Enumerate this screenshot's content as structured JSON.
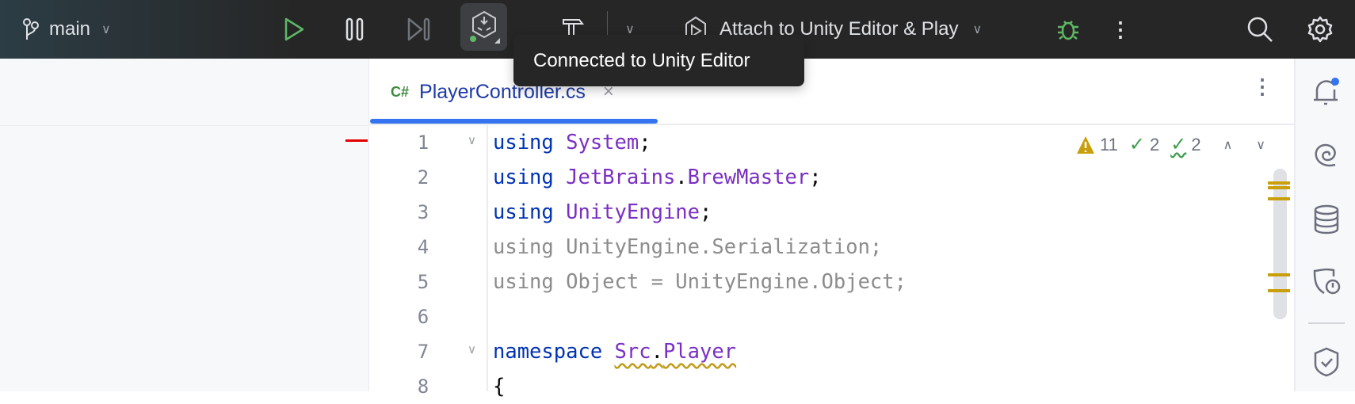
{
  "toolbar": {
    "branch": "main",
    "run_config": "Attach to Unity Editor & Play",
    "icons": [
      "branch-icon",
      "play-icon",
      "pause-icon",
      "step-icon",
      "unity-connection-icon",
      "hammer-icon",
      "chevron-down-icon",
      "run-config-icon",
      "debug-bug-icon",
      "more-icon",
      "search-icon",
      "gear-icon"
    ]
  },
  "tooltip": {
    "text": "Connected to Unity Editor"
  },
  "tab": {
    "lang": "C#",
    "filename": "PlayerController.cs"
  },
  "inspections": {
    "warnings": "11",
    "weak_warnings": "2",
    "typos": "2"
  },
  "editor": {
    "line_numbers": [
      "1",
      "2",
      "3",
      "4",
      "5",
      "6",
      "7",
      "8"
    ],
    "lines": [
      [
        {
          "t": "using",
          "c": "kw"
        },
        {
          "t": " ",
          "c": "pl"
        },
        {
          "t": "System",
          "c": "ns"
        },
        {
          "t": ";",
          "c": "pl"
        }
      ],
      [
        {
          "t": "using",
          "c": "kw"
        },
        {
          "t": " ",
          "c": "pl"
        },
        {
          "t": "JetBrains",
          "c": "ns"
        },
        {
          "t": ".",
          "c": "pl"
        },
        {
          "t": "BrewMaster",
          "c": "ns"
        },
        {
          "t": ";",
          "c": "pl"
        }
      ],
      [
        {
          "t": "using",
          "c": "kw"
        },
        {
          "t": " ",
          "c": "pl"
        },
        {
          "t": "UnityEngine",
          "c": "ns"
        },
        {
          "t": ";",
          "c": "pl"
        }
      ],
      [
        {
          "t": "using UnityEngine.Serialization;",
          "c": "un"
        }
      ],
      [
        {
          "t": "using Object = UnityEngine.Object;",
          "c": "un"
        }
      ],
      [],
      [
        {
          "t": "namespace",
          "c": "kw"
        },
        {
          "t": " ",
          "c": "pl"
        },
        {
          "t": "Src",
          "c": "ns wavy"
        },
        {
          "t": ".",
          "c": "pl wavy"
        },
        {
          "t": "Player",
          "c": "ns wavy"
        }
      ],
      [
        {
          "t": "{",
          "c": "pl"
        }
      ]
    ]
  },
  "colors": {
    "accent": "#3574f0",
    "run": "#5fb865",
    "warning": "#c9a00b",
    "error_mark": "#e50000"
  }
}
